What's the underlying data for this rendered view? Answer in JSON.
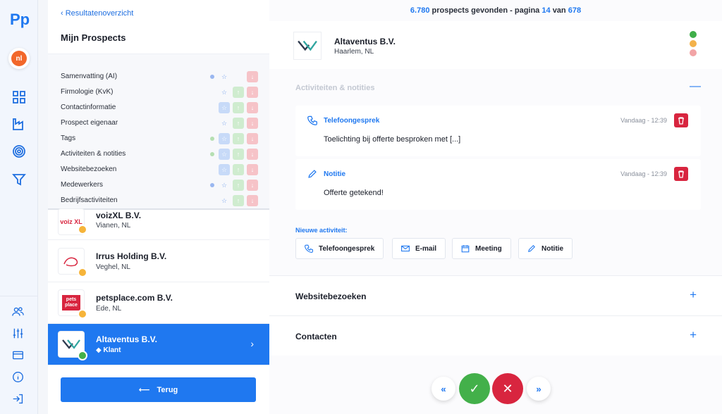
{
  "rail": {
    "language": "nl",
    "nav_icons": [
      "grid-icon",
      "factory-icon",
      "target-icon",
      "filter-icon"
    ],
    "bottom_icons": [
      "users-icon",
      "sliders-icon",
      "card-icon",
      "info-icon",
      "logout-icon"
    ]
  },
  "panel": {
    "back_link": "Resultatenoverzicht",
    "title": "Mijn Prospects",
    "sections": [
      {
        "label": "Samenvatting (AI)",
        "dot": "#9ab7f0"
      },
      {
        "label": "Firmologie (KvK)"
      },
      {
        "label": "Contactinformatie"
      },
      {
        "label": "Prospect eigenaar"
      },
      {
        "label": "Tags",
        "dot": "#b5dfb2"
      },
      {
        "label": "Activiteiten & notities",
        "dot": "#b5dfb2"
      },
      {
        "label": "Websitebezoeken"
      },
      {
        "label": "Medewerkers",
        "dot": "#9ab7f0"
      },
      {
        "label": "Bedrijfsactiviteiten"
      }
    ],
    "companies": [
      {
        "name": "voizXL B.V.",
        "location": "Vianen, NL",
        "logo_text": "voiz XL"
      },
      {
        "name": "Irrus Holding B.V.",
        "location": "Veghel, NL",
        "logo_text": ""
      },
      {
        "name": "petsplace.com B.V.",
        "location": "Ede, NL",
        "logo_text": "pets place"
      },
      {
        "name": "Altaventus B.V.",
        "tag": "Klant",
        "active": true
      }
    ],
    "back_button": "Terug"
  },
  "main": {
    "count_number": "6.780",
    "count_text": "prospects gevonden - pagina",
    "page": "14",
    "of_text": "van",
    "total_pages": "678",
    "company_name": "Altaventus B.V.",
    "company_location": "Haarlem, NL",
    "status_dots": [
      "#3fae49",
      "#f3b14a",
      "#f2a4a6"
    ],
    "activities": {
      "title": "Activiteiten & notities",
      "items": [
        {
          "type": "Telefoongesprek",
          "time": "Vandaag - 12:39",
          "body": "Toelichting bij offerte besproken met [...]"
        },
        {
          "type": "Notitie",
          "time": "Vandaag - 12:39",
          "body": "Offerte getekend!"
        }
      ],
      "new_label": "Nieuwe activiteit:",
      "new_buttons": [
        "Telefoongesprek",
        "E-mail",
        "Meeting",
        "Notitie"
      ]
    },
    "sections_collapsed": [
      "Websitebezoeken",
      "Contacten"
    ]
  },
  "colors": {
    "accent": "#1f78f0",
    "approve": "#43b04a",
    "reject": "#d8253f"
  }
}
